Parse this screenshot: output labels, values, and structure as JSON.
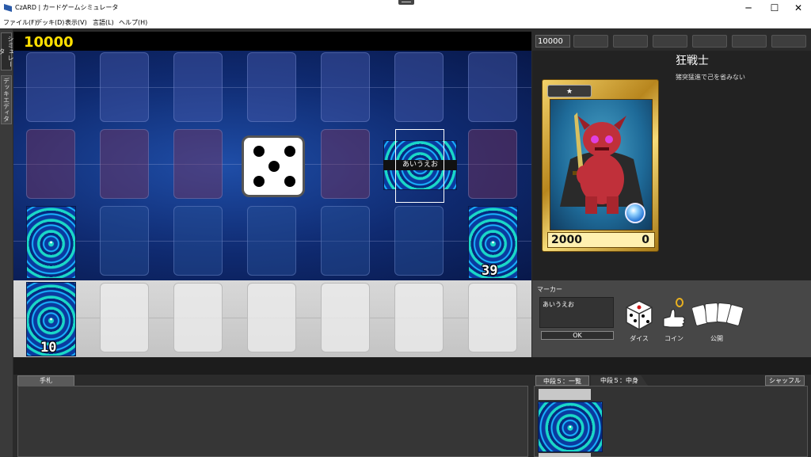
{
  "window": {
    "title": "CzARD | カードゲームシミュレータ",
    "minimize": "─",
    "maximize": "☐",
    "close": "✕"
  },
  "menu": [
    "ファイル(F)",
    "デッキ(D)",
    "表示(V)",
    "言語(L)",
    "ヘルプ(H)"
  ],
  "side_tabs": [
    "シミュレータ",
    "デッキエディタ"
  ],
  "board": {
    "score": "10000",
    "card_label": "あいうえお",
    "deck_count_right": "39",
    "deck_count_left": "10",
    "dice_face": 5
  },
  "right_panel": {
    "life": "10000",
    "card": {
      "name": "狂戦士",
      "description": "猪突猛進で己を省みない",
      "level_star": "★",
      "attack": "2000",
      "defense": "0"
    }
  },
  "marker": {
    "title": "マーカー",
    "input_value": "あいうえお",
    "ok_label": "OK",
    "dice_label": "ダイス",
    "coin_label": "コイン",
    "reveal_label": "公開"
  },
  "bottom": {
    "hand_tab": "手札",
    "tab_list": "中段５：一覧",
    "tab_contents": "中段５：中身",
    "shuffle": "シャッフル"
  },
  "colors": {
    "score_yellow": "#ffe000",
    "field_blue": "#1f4ea8",
    "card_gold": "#d4a52a",
    "monster_red": "#c0303a"
  }
}
